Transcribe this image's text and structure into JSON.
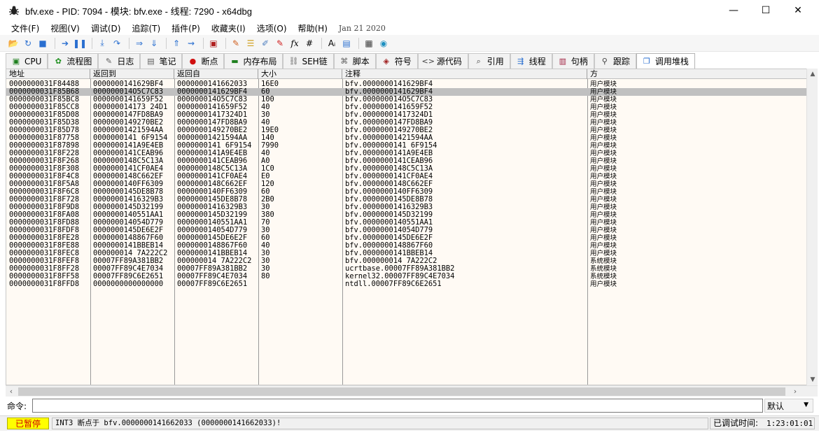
{
  "window": {
    "title": "bfv.exe - PID: 7094 - 模块: bfv.exe - 线程: 7290 - x64dbg",
    "controls": {
      "minimize": "—",
      "maximize": "☐",
      "close": "✕"
    }
  },
  "menu": {
    "items": [
      "文件(F)",
      "视图(V)",
      "调试(D)",
      "追踪(T)",
      "插件(P)",
      "收藏夹(I)",
      "选项(O)",
      "帮助(H)"
    ],
    "date": "Jan 21 2020"
  },
  "toolbar": {
    "icons": [
      {
        "name": "open-icon",
        "glyph": "📂",
        "color": "#d8a030"
      },
      {
        "name": "restart-icon",
        "glyph": "↻",
        "color": "#2a6fd0"
      },
      {
        "name": "stop-icon",
        "glyph": "■",
        "color": "#2a6fd0"
      },
      {
        "name": "sep"
      },
      {
        "name": "run-icon",
        "glyph": "➔",
        "color": "#2a6fd0"
      },
      {
        "name": "pause-icon",
        "glyph": "❚❚",
        "color": "#2a6fd0"
      },
      {
        "name": "sep"
      },
      {
        "name": "step-into-icon",
        "glyph": "⤓",
        "color": "#2a6fd0"
      },
      {
        "name": "step-over-icon",
        "glyph": "↷",
        "color": "#2a6fd0"
      },
      {
        "name": "sep"
      },
      {
        "name": "trace-into-icon",
        "glyph": "⇒",
        "color": "#2a6fd0"
      },
      {
        "name": "trace-over-icon",
        "glyph": "⇓",
        "color": "#2a6fd0"
      },
      {
        "name": "sep"
      },
      {
        "name": "execute-till-return-icon",
        "glyph": "⇑",
        "color": "#2a6fd0"
      },
      {
        "name": "run-to-user-code-icon",
        "glyph": "⇝",
        "color": "#2a6fd0"
      },
      {
        "name": "sep"
      },
      {
        "name": "scylla-icon",
        "glyph": "▣",
        "color": "#b02020"
      },
      {
        "name": "sep"
      },
      {
        "name": "patch-icon",
        "glyph": "✎",
        "color": "#d06020"
      },
      {
        "name": "comments-icon",
        "glyph": "☰",
        "color": "#d0a020"
      },
      {
        "name": "labels-icon",
        "glyph": "✐",
        "color": "#5080c0"
      },
      {
        "name": "bookmarks-icon",
        "glyph": "✎",
        "color": "#d02020"
      },
      {
        "name": "functions-icon",
        "glyph": "fx",
        "color": "#000000"
      },
      {
        "name": "hash-icon",
        "glyph": "#",
        "color": "#000000"
      },
      {
        "name": "sep"
      },
      {
        "name": "strings-icon",
        "glyph": "Aᵢ",
        "color": "#000000"
      },
      {
        "name": "database-icon",
        "glyph": "▤",
        "color": "#2a6fd0"
      },
      {
        "name": "sep"
      },
      {
        "name": "calculator-icon",
        "glyph": "▦",
        "color": "#404040"
      },
      {
        "name": "globe-icon",
        "glyph": "◉",
        "color": "#1e90c0"
      }
    ]
  },
  "tabs": [
    {
      "label": "CPU",
      "icon": "cpu-icon",
      "glyph": "▣",
      "color": "#208020"
    },
    {
      "label": "流程图",
      "icon": "graph-icon",
      "glyph": "✿",
      "color": "#209020"
    },
    {
      "label": "日志",
      "icon": "log-icon",
      "glyph": "✎",
      "color": "#606060"
    },
    {
      "label": "笔记",
      "icon": "notes-icon",
      "glyph": "▤",
      "color": "#606060"
    },
    {
      "label": "断点",
      "icon": "breakpoint-icon",
      "glyph": "●",
      "color": "#d01010"
    },
    {
      "label": "内存布局",
      "icon": "memory-map-icon",
      "glyph": "▬",
      "color": "#208020"
    },
    {
      "label": "SEH链",
      "icon": "seh-chain-icon",
      "glyph": "⛓",
      "color": "#707070"
    },
    {
      "label": "脚本",
      "icon": "script-icon",
      "glyph": "⌘",
      "color": "#606060"
    },
    {
      "label": "符号",
      "icon": "symbols-icon",
      "glyph": "◈",
      "color": "#a02020"
    },
    {
      "label": "源代码",
      "icon": "source-icon",
      "glyph": "<>",
      "color": "#404040"
    },
    {
      "label": "引用",
      "icon": "references-icon",
      "glyph": "⌕",
      "color": "#404040"
    },
    {
      "label": "线程",
      "icon": "threads-icon",
      "glyph": "⇶",
      "color": "#2a6fd0"
    },
    {
      "label": "句柄",
      "icon": "handles-icon",
      "glyph": "▥",
      "color": "#a02040"
    },
    {
      "label": "跟踪",
      "icon": "trace-icon",
      "glyph": "⚲",
      "color": "#404040"
    },
    {
      "label": "调用堆栈",
      "icon": "call-stack-icon",
      "glyph": "❐",
      "color": "#2a6fd0"
    }
  ],
  "active_tab": 14,
  "table": {
    "headers": [
      "地址",
      "返回到",
      "返回自",
      "大小",
      "注释",
      "方"
    ],
    "selected_row": 1,
    "rows": [
      [
        "0000000031F84488",
        "0000000141629BF4",
        "0000000141662033",
        "16E0",
        "bfv.0000000141629BF4",
        "用户模块"
      ],
      [
        "0000000031F85B68",
        "000000014O5C7C83",
        "0000000141629BF4",
        "60",
        "bfv.0000000141629BF4",
        "用户模块"
      ],
      [
        "0000000031F85BC8",
        "0000000141659F52",
        "000000014O5C7C83",
        "100",
        "bfv.000000014O5C7C83",
        "用户模块"
      ],
      [
        "0000000031F85CC8",
        "000000014173 24D1",
        "0000000141659F52",
        "40",
        "bfv.0000000141659F52",
        "用户模块"
      ],
      [
        "0000000031F85D08",
        "0000000147FD8BA9",
        "00000001417324D1",
        "30",
        "bfv.00000001417324D1",
        "用户模块"
      ],
      [
        "0000000031F85D38",
        "0000000149270BE2",
        "0000000147FD8BA9",
        "40",
        "bfv.0000000147FD8BA9",
        "用户模块"
      ],
      [
        "0000000031F85D78",
        "00000001421594AA",
        "0000000149270BE2",
        "19E0",
        "bfv.0000000149270BE2",
        "用户模块"
      ],
      [
        "0000000031F87758",
        "0000000141 6F9154",
        "00000001421594AA",
        "140",
        "bfv.00000001421594AA",
        "用户模块"
      ],
      [
        "0000000031F87898",
        "0000000141A9E4EB",
        "0000000141 6F9154",
        "7990",
        "bfv.0000000141 6F9154",
        "用户模块"
      ],
      [
        "0000000031F8F228",
        "0000000141CEAB96",
        "0000000141A9E4EB",
        "40",
        "bfv.0000000141A9E4EB",
        "用户模块"
      ],
      [
        "0000000031F8F268",
        "0000000148C5C13A",
        "0000000141CEAB96",
        "A0",
        "bfv.0000000141CEAB96",
        "用户模块"
      ],
      [
        "0000000031F8F308",
        "0000000141CF0AE4",
        "0000000148C5C13A",
        "1C0",
        "bfv.0000000148C5C13A",
        "用户模块"
      ],
      [
        "0000000031F8F4C8",
        "0000000148C662EF",
        "0000000141CF0AE4",
        "E0",
        "bfv.0000000141CF0AE4",
        "用户模块"
      ],
      [
        "0000000031F8F5A8",
        "0000000140FF6309",
        "0000000148C662EF",
        "120",
        "bfv.0000000148C662EF",
        "用户模块"
      ],
      [
        "0000000031F8F6C8",
        "0000000145DE8B78",
        "0000000140FF6309",
        "60",
        "bfv.0000000140FF6309",
        "用户模块"
      ],
      [
        "0000000031F8F728",
        "00000001416329B3",
        "0000000145DE8B78",
        "2B0",
        "bfv.0000000145DE8B78",
        "用户模块"
      ],
      [
        "0000000031F8F9D8",
        "0000000145D32199",
        "00000001416329B3",
        "30",
        "bfv.00000001416329B3",
        "用户模块"
      ],
      [
        "0000000031F8FA08",
        "0000000140551AA1",
        "0000000145D32199",
        "380",
        "bfv.0000000145D32199",
        "用户模块"
      ],
      [
        "0000000031F8FD88",
        "000000014054D779",
        "0000000140551AA1",
        "70",
        "bfv.0000000140551AA1",
        "用户模块"
      ],
      [
        "0000000031F8FDF8",
        "0000000145DE6E2F",
        "000000014054D779",
        "30",
        "bfv.000000014054D779",
        "用户模块"
      ],
      [
        "0000000031F8FE28",
        "0000000148867F60",
        "0000000145DE6E2F",
        "60",
        "bfv.0000000145DE6E2F",
        "用户模块"
      ],
      [
        "0000000031F8FE88",
        "0000000141BBEB14",
        "0000000148867F60",
        "40",
        "bfv.0000000148867F60",
        "用户模块"
      ],
      [
        "0000000031F8FEC8",
        "000000014 7A222C2",
        "0000000141BBEB14",
        "30",
        "bfv.0000000141BBEB14",
        "用户模块"
      ],
      [
        "0000000031F8FEF8",
        "00007FF89A381BB2",
        "000000014 7A222C2",
        "30",
        "bfv.000000014 7A222C2",
        "系统模块"
      ],
      [
        "0000000031F8FF28",
        "00007FF89C4E7034",
        "00007FF89A381BB2",
        "30",
        "ucrtbase.00007FF89A381BB2",
        "系统模块"
      ],
      [
        "0000000031F8FF58",
        "00007FF89C6E2651",
        "00007FF89C4E7034",
        "80",
        "kernel32.00007FF89C4E7034",
        "系统模块"
      ],
      [
        "0000000031F8FFD8",
        "0000000000000000",
        "00007FF89C6E2651",
        "",
        "ntdll.00007FF89C6E2651",
        "用户模块"
      ]
    ]
  },
  "command": {
    "label": "命令:",
    "value": "",
    "placeholder": "",
    "mode": "默认"
  },
  "status": {
    "state": "已暂停",
    "message": "INT3 断点于 bfv.0000000141662033 (0000000141662033)!",
    "elapsed_label": "已调试时间:",
    "elapsed_value": "1:23:01:01"
  },
  "colors": {
    "selected_row": "#c0c0c0",
    "grid_bg": "#fffaf4",
    "state_bg": "#ffff00",
    "state_fg": "#d00000"
  }
}
